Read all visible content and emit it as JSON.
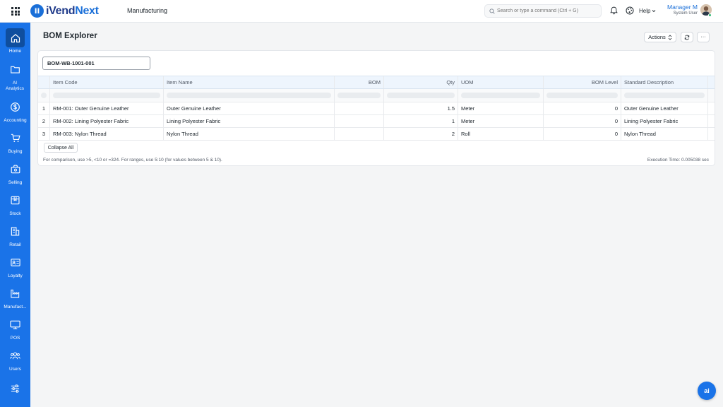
{
  "app": {
    "logo_prefix": "iVend",
    "logo_suffix": "Next",
    "logo_mark": "ii",
    "breadcrumb": "Manufacturing",
    "brand_color": "#1a73e8"
  },
  "topbar": {
    "search_placeholder": "Search or type a command (Ctrl + G)",
    "help_label": "Help",
    "user_name": "Manager M",
    "user_role": "System User"
  },
  "sidebar": {
    "items": [
      {
        "label": "Home",
        "icon": "home-icon"
      },
      {
        "label": "AI Analytics",
        "icon": "folder-icon"
      },
      {
        "label": "Accounting",
        "icon": "dollar-icon"
      },
      {
        "label": "Buying",
        "icon": "cart-icon"
      },
      {
        "label": "Selling",
        "icon": "bag-icon"
      },
      {
        "label": "Stock",
        "icon": "box-icon"
      },
      {
        "label": "Retail",
        "icon": "store-icon"
      },
      {
        "label": "Loyalty",
        "icon": "id-card-icon"
      },
      {
        "label": "Manufact...",
        "icon": "factory-icon"
      },
      {
        "label": "POS",
        "icon": "monitor-icon"
      },
      {
        "label": "Users",
        "icon": "users-icon"
      },
      {
        "label": "",
        "icon": "sliders-icon"
      }
    ]
  },
  "page": {
    "title": "BOM Explorer",
    "actions_label": "Actions",
    "more_label": "···",
    "bom_value": "BOM-WB-1001-001"
  },
  "table": {
    "columns": [
      "Item Code",
      "Item Name",
      "BOM",
      "Qty",
      "UOM",
      "BOM Level",
      "Standard Description"
    ],
    "rows": [
      {
        "num": "1",
        "item_code": "RM-001: Outer Genuine Leather",
        "item_name": "Outer Genuine Leather",
        "bom": "",
        "qty": "1.5",
        "uom": "Meter",
        "bom_level": "0",
        "description": "Outer Genuine Leather"
      },
      {
        "num": "2",
        "item_code": "RM-002: Lining Polyester Fabric",
        "item_name": "Lining Polyester Fabric",
        "bom": "",
        "qty": "1",
        "uom": "Meter",
        "bom_level": "0",
        "description": "Lining Polyester Fabric"
      },
      {
        "num": "3",
        "item_code": "RM-003: Nylon Thread",
        "item_name": "Nylon Thread",
        "bom": "",
        "qty": "2",
        "uom": "Roll",
        "bom_level": "0",
        "description": "Nylon Thread"
      }
    ]
  },
  "footer": {
    "collapse_label": "Collapse All",
    "hint": "For comparison, use >5, <10 or =324. For ranges, use 5:10 (for values between 5 & 10).",
    "execution_time": "Execution Time: 0.005038 sec"
  },
  "fab": {
    "label": "ai"
  }
}
